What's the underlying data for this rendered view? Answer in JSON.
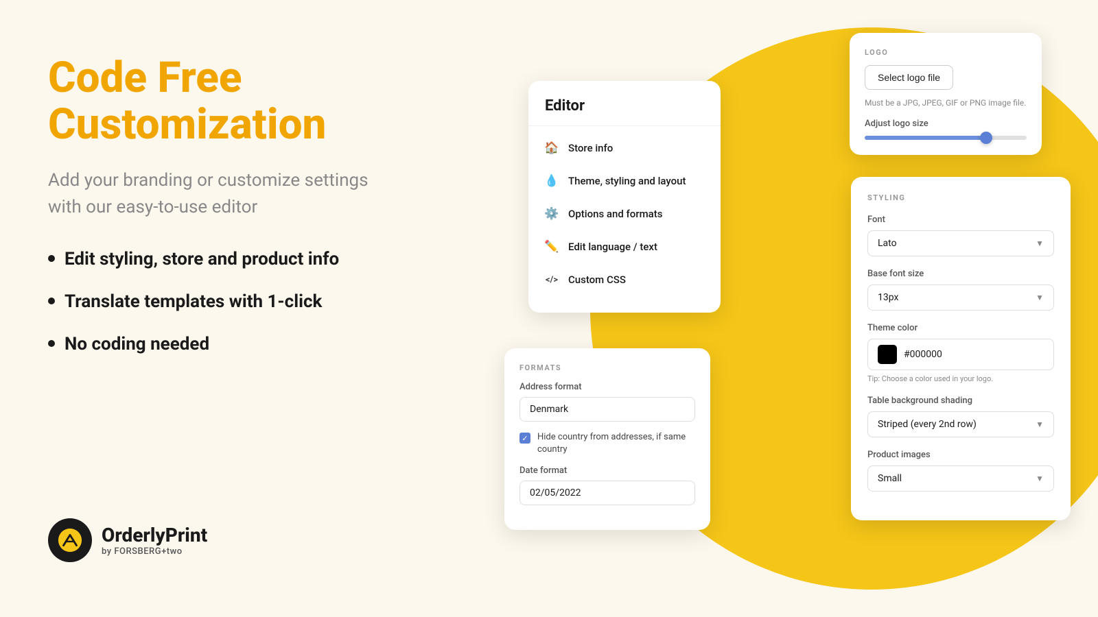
{
  "left": {
    "title_line1": "Code Free",
    "title_line2": "Customization",
    "subtitle": "Add your branding or customize settings with our easy-to-use editor",
    "bullets": [
      "Edit styling, store and product info",
      "Translate templates with 1-click",
      "No coding needed"
    ],
    "logo": {
      "name": "OrderlyPrint",
      "sub": "by FORSBERG+two"
    }
  },
  "editor_card": {
    "title": "Editor",
    "menu_items": [
      {
        "icon": "🏠",
        "label": "Store info"
      },
      {
        "icon": "💧",
        "label": "Theme, styling and layout"
      },
      {
        "icon": "⚙️",
        "label": "Options and formats"
      },
      {
        "icon": "✏️",
        "label": "Edit language / text"
      },
      {
        "icon": "</>",
        "label": "Custom CSS"
      }
    ]
  },
  "logo_card": {
    "section_label": "LOGO",
    "button_label": "Select logo file",
    "hint": "Must be a JPG, JPEG, GIF or PNG image file.",
    "adjust_label": "Adjust logo size",
    "slider_fill_percent": 75
  },
  "styling_card": {
    "section_label": "STYLING",
    "font_label": "Font",
    "font_value": "Lato",
    "base_font_label": "Base font size",
    "base_font_value": "13px",
    "theme_color_label": "Theme color",
    "theme_color_value": "#000000",
    "color_tip": "Tip: Choose a color used in your logo.",
    "table_bg_label": "Table background shading",
    "table_bg_value": "Striped (every 2nd row)",
    "product_images_label": "Product images",
    "product_images_value": "Small"
  },
  "formats_card": {
    "section_label": "FORMATS",
    "address_format_label": "Address format",
    "address_format_value": "Denmark",
    "checkbox_text": "Hide country from addresses, if same country",
    "date_format_label": "Date format",
    "date_format_value": "02/05/2022"
  }
}
